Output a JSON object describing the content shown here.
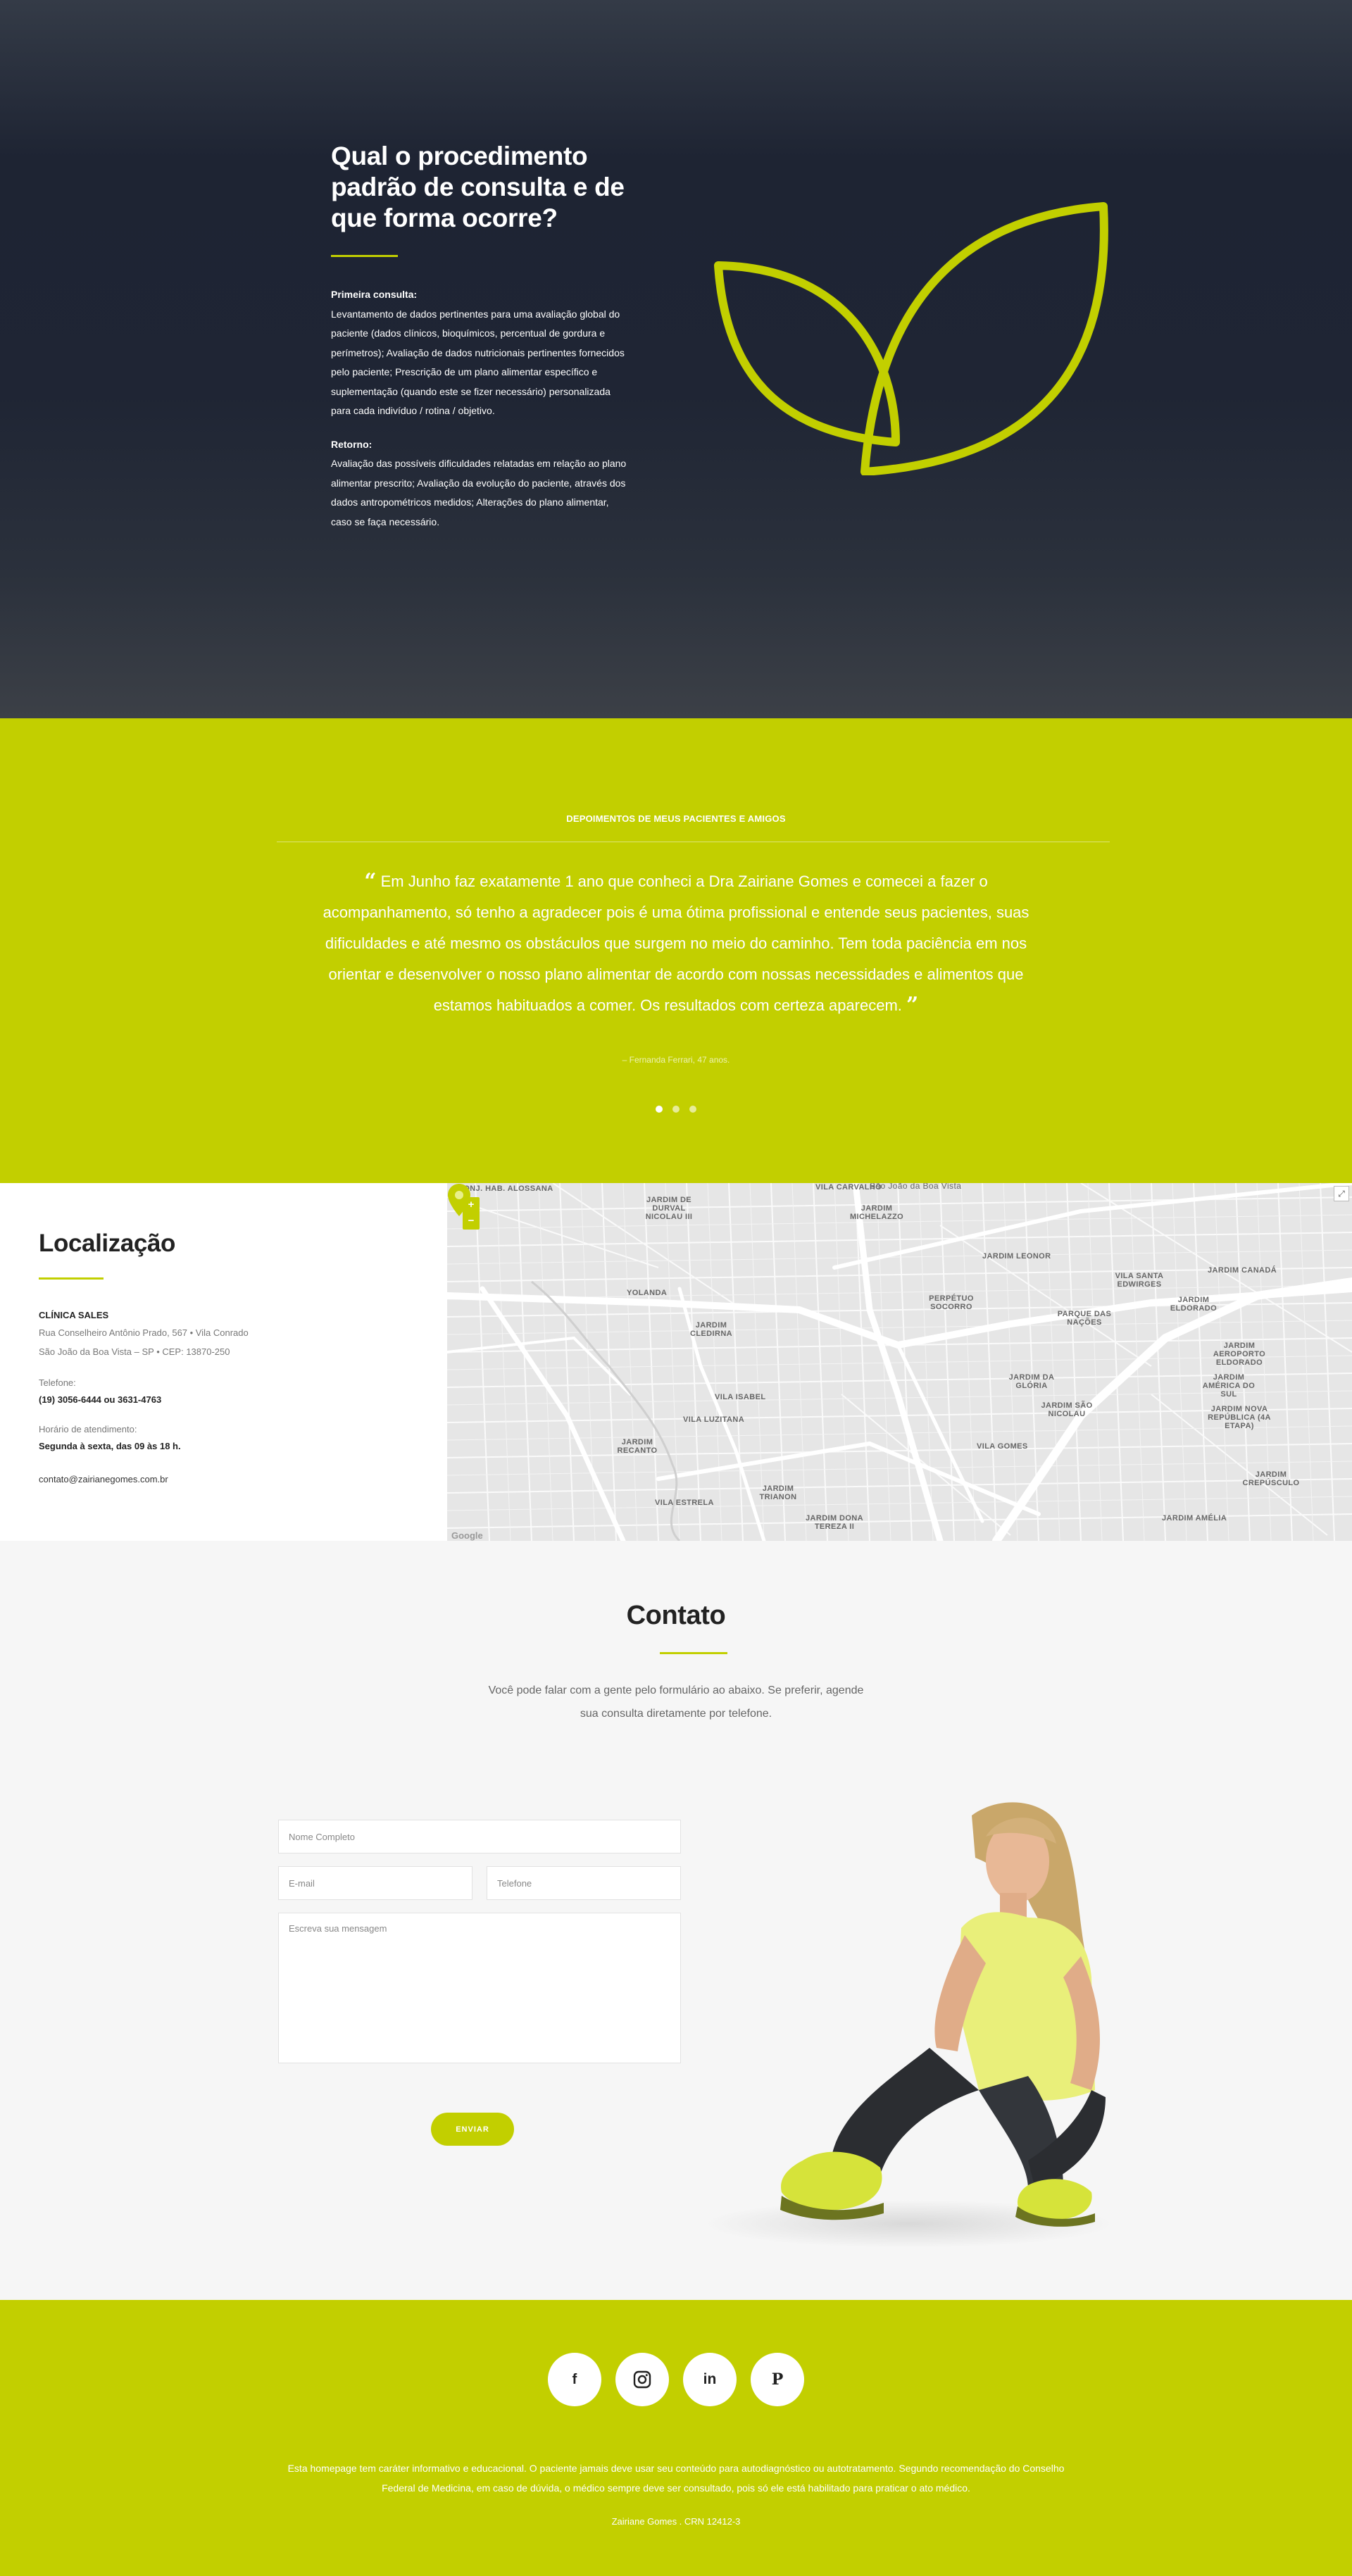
{
  "faq": {
    "title": "Qual o procedimento padrão de consulta e de que forma ocorre?",
    "first_label": "Primeira consulta:",
    "first_text": "Levantamento de dados pertinentes para uma avaliação global do paciente (dados clínicos, bioquímicos, percentual de gordura e perímetros); Avaliação de dados nutricionais pertinentes fornecidos pelo paciente; Prescrição de um plano alimentar específico e suplementação (quando este se fizer necessário) personalizada para cada indivíduo / rotina / objetivo.",
    "return_label": "Retorno:",
    "return_text": "Avaliação das possíveis dificuldades relatadas em relação ao plano alimentar prescrito; Avaliação da evolução do paciente, através dos dados antropométricos medidos; Alterações do plano alimentar, caso se faça necessário.",
    "logo_icon": "leaf-logo-icon"
  },
  "testimonials": {
    "heading": "DEPOIMENTOS DE MEUS PACIENTES E AMIGOS",
    "quote_open": "“",
    "quote": "Em Junho faz exatamente 1 ano que conheci a Dra Zairiane Gomes e comecei a fazer o acompanhamento, só tenho a agradecer pois é uma ótima profissional e entende seus pacientes, suas dificuldades e até mesmo os obstáculos que surgem no meio do caminho. Tem toda paciência em nos orientar e desenvolver o nosso plano alimentar de acordo com nossas necessidades e alimentos que estamos habituados a comer. Os resultados com certeza aparecem.",
    "quote_close": "”",
    "author": "– Fernanda Ferrari, 47 anos.",
    "slides": 3,
    "active_slide": 1
  },
  "location": {
    "title": "Localização",
    "clinic": "CLÍNICA SALES",
    "address_1": "Rua Conselheiro Antônio Prado, 567 • Vila Conrado",
    "address_2": "São João da Boa Vista – SP • CEP: 13870-250",
    "phone_label": "Telefone:",
    "phone": "(19) 3056-6444 ou 3631-4763",
    "hours_label": "Horário de atendimento:",
    "hours": "Segunda à sexta, das 09 às 18 h.",
    "email": "contato@zairianegomes.com.br",
    "map": {
      "zoom_in": "+",
      "zoom_out": "−",
      "fullscreen": "⤢",
      "attribution": "Google",
      "pin_icon": "map-pin-icon",
      "labels": [
        "VILA CARVALHO",
        "JARDIM DE DURVAL NICOLAU III",
        "JARDIM MICHELAZZO",
        "JARDIM LEONOR",
        "JARDIM CANADÁ",
        "YOLANDA",
        "PERPÉTUO SOCORRO",
        "VILA SANTA EDWIRGES",
        "PARQUE DAS NAÇÕES",
        "JARDIM ELDORADO",
        "JARDIM CLEDIRNA",
        "VILA ISABEL",
        "VILA LUZITANA",
        "JARDIM DA GLÓRIA",
        "JARDIM AEROPORTO ELDORADO",
        "JARDIM AMÉRICA DO SUL",
        "JARDIM SÃO NICOLAU",
        "JARDIM NOVA REPÚBLICA (4A ETAPA)",
        "VILA GOMES",
        "JARDIM RECANTO",
        "JARDIM TRIANON",
        "VILA ESTRELA",
        "JARDIM DONA TEREZA II",
        "JARDIM AMÉLIA",
        "JARDIM CREPÚSCULO",
        "CONJ. HAB. ALOSSANA",
        "São João da Boa Vista"
      ]
    }
  },
  "contact": {
    "title": "Contato",
    "intro": "Você pode falar com a gente pelo formulário ao abaixo. Se preferir, agende sua consulta diretamente por telefone.",
    "name_placeholder": "Nome Completo",
    "email_placeholder": "E-mail",
    "phone_placeholder": "Telefone",
    "message_placeholder": "Escreva sua mensagem",
    "send_label": "ENVIAR",
    "photo_icon": "nutritionist-photo"
  },
  "footer": {
    "social": [
      {
        "icon": "facebook-icon",
        "glyph": "f"
      },
      {
        "icon": "instagram-icon",
        "glyph": ""
      },
      {
        "icon": "linkedin-icon",
        "glyph": "in"
      },
      {
        "icon": "pinterest-icon",
        "glyph": "P"
      }
    ],
    "note": "Esta homepage tem caráter informativo e educacional. O paciente jamais deve usar seu conteúdo para autodiagnóstico ou autotratamento. Segundo recomendação do Conselho Federal de Medicina, em caso de dúvida, o médico sempre deve ser consultado, pois só ele está habilitado para praticar o ato médico.",
    "crn": "Zairiane Gomes . CRN 12412-3"
  },
  "colors": {
    "accent": "#c2cf00",
    "dark": "#1f2534",
    "text": "#222222"
  }
}
